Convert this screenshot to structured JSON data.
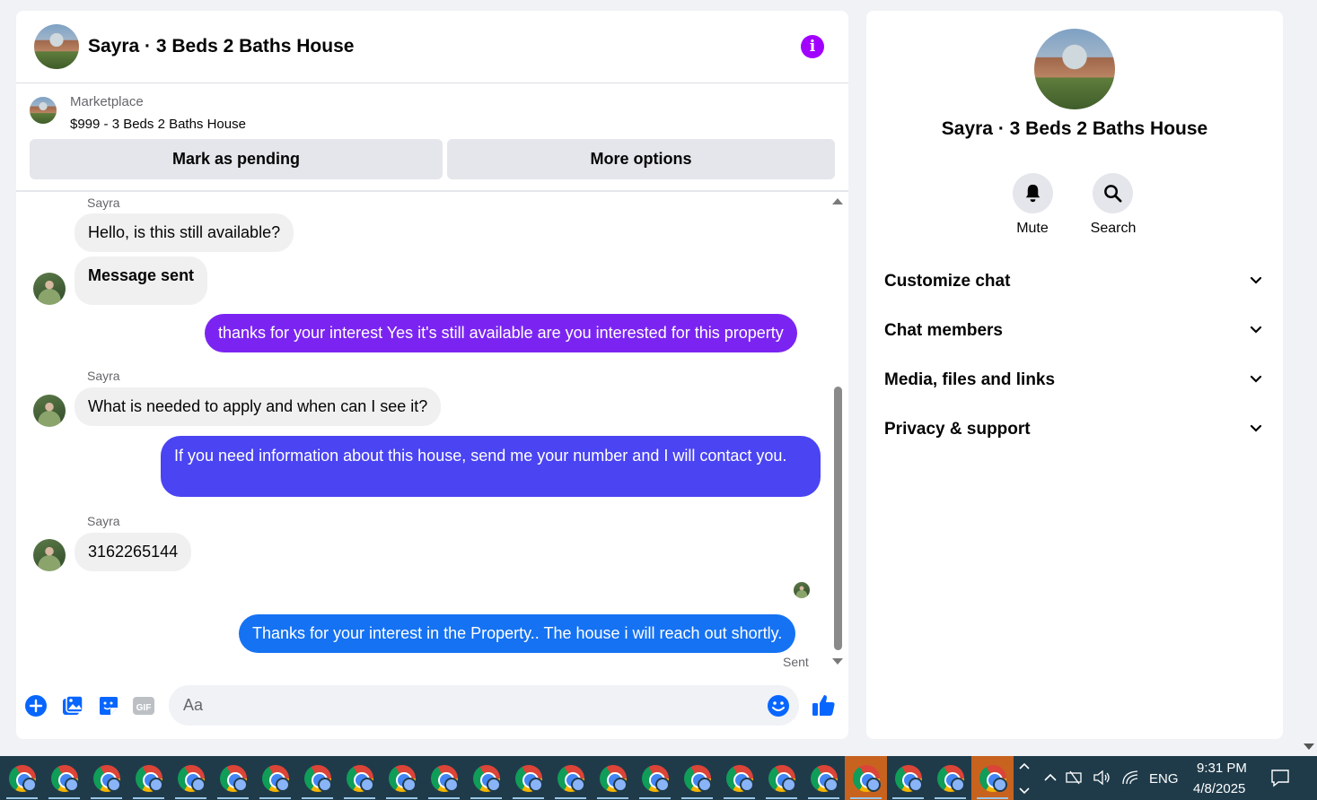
{
  "header": {
    "title": "Sayra · 3 Beds 2 Baths House",
    "info_icon": "info-icon"
  },
  "listing": {
    "label": "Marketplace",
    "title": "$999 - 3 Beds 2 Baths House",
    "mark_pending": "Mark as pending",
    "more_options": "More options"
  },
  "messages": {
    "m1_sender": "Sayra",
    "m1_text": "Hello, is this still available?",
    "m2_text": "Message sent",
    "m3_text": "thanks for your interest Yes it's still available are you interested for this property",
    "m4_sender": "Sayra",
    "m4_text": "What is needed to apply and when can I see it?",
    "m5_text": "If you need information about this house, send me your number and I will contact you.",
    "m6_sender": "Sayra",
    "m6_text": "3162265144",
    "m7_text": "Thanks for your interest in the Property.. The house i will reach  out shortly.",
    "status": "Sent"
  },
  "composer": {
    "placeholder": "Aa"
  },
  "info_panel": {
    "title": "Sayra · 3 Beds 2 Baths House",
    "mute": "Mute",
    "search": "Search",
    "sections": [
      "Customize chat",
      "Chat members",
      "Media, files and links",
      "Privacy & support"
    ]
  },
  "taskbar": {
    "lang": "ENG",
    "time": "9:31 PM",
    "date": "4/8/2025"
  },
  "colors": {
    "accent_purple": "#a100ff",
    "bubble_purple": "#7b24f2",
    "bubble_indigo": "#4a44f2",
    "bubble_blue": "#1572f2"
  }
}
